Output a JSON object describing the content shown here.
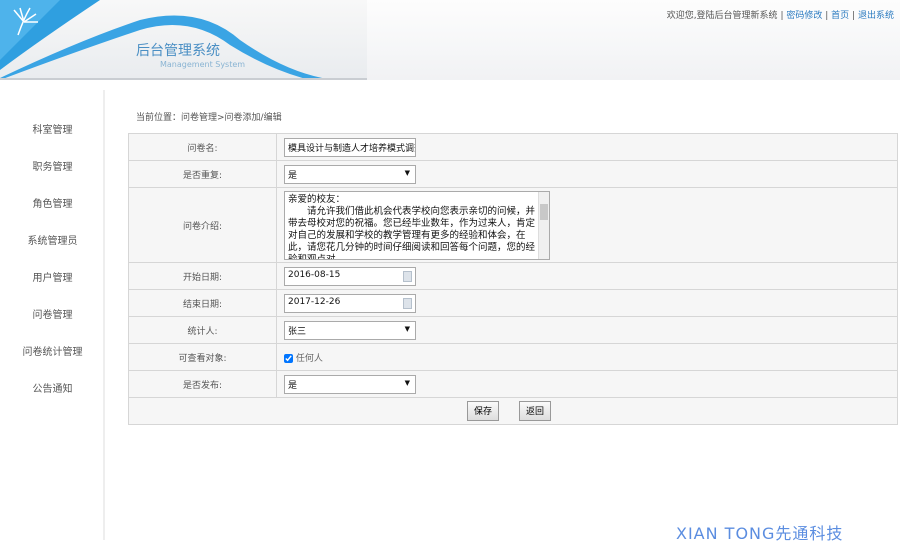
{
  "header": {
    "title": "后台管理系统",
    "subtitle": "Management System",
    "welcome": "欢迎您,登陆后台管理新系统",
    "links": [
      "密码修改",
      "首页",
      "退出系统"
    ],
    "sep": "|"
  },
  "sidebar": {
    "items": [
      "科室管理",
      "职务管理",
      "角色管理",
      "系统管理员",
      "用户管理",
      "问卷管理",
      "问卷统计管理",
      "公告通知"
    ]
  },
  "breadcrumb": "当前位置：问卷管理>问卷添加/编辑",
  "form": {
    "name_label": "问卷名:",
    "name_value": "模具设计与制造人才培养模式调查表",
    "repeat_label": "是否重复:",
    "repeat_value": "是",
    "intro_label": "问卷介绍:",
    "intro_value": "亲爱的校友：\n　　请允许我们借此机会代表学校向您表示亲切的问候，并带去母校对您的祝福。您已经毕业数年，作为过来人，肯定对自己的发展和学校的教学管理有更多的经验和体会，在此，请您花几分钟的时间仔细阅读和回答每个问题，您的经验和观点对",
    "start_label": "开始日期:",
    "start_value": "2016-08-15",
    "end_label": "结束日期:",
    "end_value": "2017-12-26",
    "stat_label": "统计人:",
    "stat_value": "张三",
    "viewer_label": "可查看对象:",
    "viewer_option": "任何人",
    "viewer_checked": true,
    "publish_label": "是否发布:",
    "publish_value": "是",
    "save": "保存",
    "back": "返回"
  },
  "watermark": "XIAN  TONG先通科技",
  "colors": {
    "accent": "#2a7ac0"
  }
}
